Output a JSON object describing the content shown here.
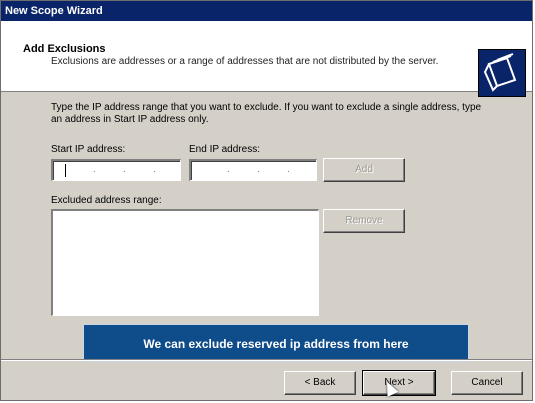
{
  "window": {
    "title": "New Scope Wizard"
  },
  "header": {
    "title": "Add Exclusions",
    "subtitle": "Exclusions are addresses or a range of addresses that are not distributed by the server."
  },
  "content": {
    "instructions": "Type the IP address range that you want to exclude. If you want to exclude a single address, type an address in Start IP address only.",
    "start_ip_label": "Start IP address:",
    "start_ip_value": "",
    "end_ip_label": "End IP address:",
    "end_ip_value": "",
    "add_button": "Add",
    "excluded_label": "Excluded address range:",
    "excluded_items": [],
    "remove_button": "Remove"
  },
  "banner": {
    "text": "We can exclude reserved ip address from here"
  },
  "footer": {
    "back_button": "< Back",
    "next_button": "Next >",
    "cancel_button": "Cancel"
  },
  "colors": {
    "titlebar": "#0a246a",
    "banner": "#0f4c8a",
    "dialog_bg": "#d4d0c8"
  }
}
